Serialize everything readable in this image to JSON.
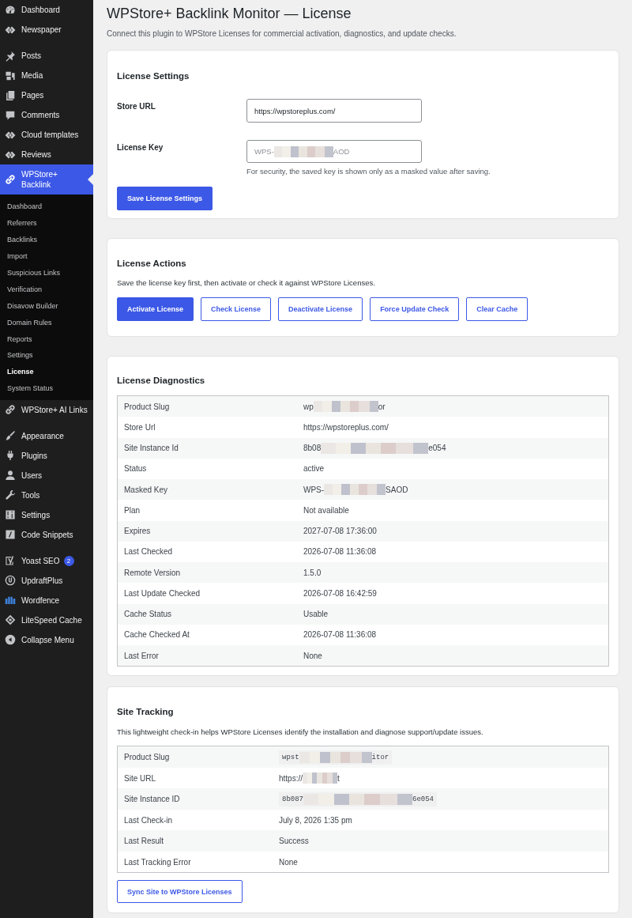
{
  "sidebar": {
    "sections": [
      {
        "items": [
          {
            "label": "Dashboard",
            "selected": false
          },
          {
            "label": "Newspaper",
            "selected": false
          }
        ]
      },
      {
        "items": [
          {
            "label": "Posts",
            "selected": false
          },
          {
            "label": "Media",
            "selected": false
          },
          {
            "label": "Pages",
            "selected": false
          },
          {
            "label": "Comments",
            "selected": false
          },
          {
            "label": "Cloud templates",
            "selected": false
          },
          {
            "label": "Reviews",
            "selected": false
          },
          {
            "label": "WPStore+ Backlink",
            "selected": true,
            "children": [
              {
                "label": "Dashboard",
                "selected": false
              },
              {
                "label": "Referrers",
                "selected": false
              },
              {
                "label": "Backlinks",
                "selected": false
              },
              {
                "label": "Import",
                "selected": false
              },
              {
                "label": "Suspicious Links",
                "selected": false
              },
              {
                "label": "Verification",
                "selected": false
              },
              {
                "label": "Disavow Builder",
                "selected": false
              },
              {
                "label": "Domain Rules",
                "selected": false
              },
              {
                "label": "Reports",
                "selected": false
              },
              {
                "label": "Settings",
                "selected": false
              },
              {
                "label": "License",
                "selected": true
              },
              {
                "label": "System Status",
                "selected": false
              }
            ]
          },
          {
            "label": "WPStore+ AI Links",
            "selected": false
          }
        ]
      },
      {
        "items": [
          {
            "label": "Appearance",
            "selected": false
          },
          {
            "label": "Plugins",
            "selected": false
          },
          {
            "label": "Users",
            "selected": false
          },
          {
            "label": "Tools",
            "selected": false
          },
          {
            "label": "Settings",
            "selected": false
          },
          {
            "label": "Code Snippets",
            "selected": false
          }
        ]
      },
      {
        "items": [
          {
            "label": "Yoast SEO",
            "selected": false,
            "badge": "2"
          },
          {
            "label": "UpdraftPlus",
            "selected": false
          },
          {
            "label": "Wordfence",
            "selected": false
          },
          {
            "label": "LiteSpeed Cache",
            "selected": false
          },
          {
            "label": "Collapse Menu",
            "selected": false
          }
        ]
      }
    ]
  },
  "page": {
    "title": "WPStore+ Backlink Monitor — License",
    "description": "Connect this plugin to WPStore Licenses for commercial activation, diagnostics, and update checks."
  },
  "license_settings": {
    "title": "License Settings",
    "fields": [
      {
        "label": "Store URL",
        "value": "https://wpstoreplus.com/"
      },
      {
        "label": "License Key",
        "placeholder_parts": [
          "WPS-",
          "AOD"
        ],
        "hint": "For security, the saved key is shown only as a masked value after saving."
      }
    ],
    "button": {
      "label": "Save License Settings",
      "kind": "primary"
    }
  },
  "license_actions": {
    "title": "License Actions",
    "description": "Save the license key first, then activate or check it against WPStore Licenses.",
    "buttons": [
      {
        "label": "Activate License",
        "kind": "primary"
      },
      {
        "label": "Check License",
        "kind": "secondary"
      },
      {
        "label": "Deactivate License",
        "kind": "secondary"
      },
      {
        "label": "Force Update Check",
        "kind": "secondary"
      },
      {
        "label": "Clear Cache",
        "kind": "secondary"
      }
    ]
  },
  "license_diagnostics": {
    "title": "License Diagnostics",
    "rows": [
      {
        "label": "Product Slug",
        "value_parts": [
          "wp",
          "or"
        ]
      },
      {
        "label": "Store Url",
        "value": "https://wpstoreplus.com/"
      },
      {
        "label": "Site Instance Id",
        "value_parts": [
          "8b08",
          "e054"
        ]
      },
      {
        "label": "Status",
        "value": "active"
      },
      {
        "label": "Masked Key",
        "value_parts": [
          "WPS-",
          "SAOD"
        ]
      },
      {
        "label": "Plan",
        "value": "Not available"
      },
      {
        "label": "Expires",
        "value": "2027-07-08 17:36:00"
      },
      {
        "label": "Last Checked",
        "value": "2026-07-08 11:36:08"
      },
      {
        "label": "Remote Version",
        "value": "1.5.0"
      },
      {
        "label": "Last Update Checked",
        "value": "2026-07-08 16:42:59"
      },
      {
        "label": "Cache Status",
        "value": "Usable"
      },
      {
        "label": "Cache Checked At",
        "value": "2026-07-08 11:36:08"
      },
      {
        "label": "Last Error",
        "value": "None"
      }
    ]
  },
  "site_tracking": {
    "title": "Site Tracking",
    "description": "This lightweight check-in helps WPStore Licenses identify the installation and diagnose support/update issues.",
    "rows": [
      {
        "label": "Product Slug",
        "kind": "code",
        "value_parts": [
          "wpst",
          "itor"
        ]
      },
      {
        "label": "Site URL",
        "kind": "text",
        "value_parts": [
          "https://",
          "t"
        ]
      },
      {
        "label": "Site Instance ID",
        "kind": "code",
        "value_parts": [
          "8b087",
          "6e054"
        ]
      },
      {
        "label": "Last Check-in",
        "kind": "text",
        "value": "July 8, 2026 1:35 pm"
      },
      {
        "label": "Last Result",
        "kind": "text",
        "value": "Success"
      },
      {
        "label": "Last Tracking Error",
        "kind": "text",
        "value": "None"
      }
    ],
    "button": {
      "label": "Sync Site to WPStore Licenses",
      "kind": "secondary"
    }
  }
}
